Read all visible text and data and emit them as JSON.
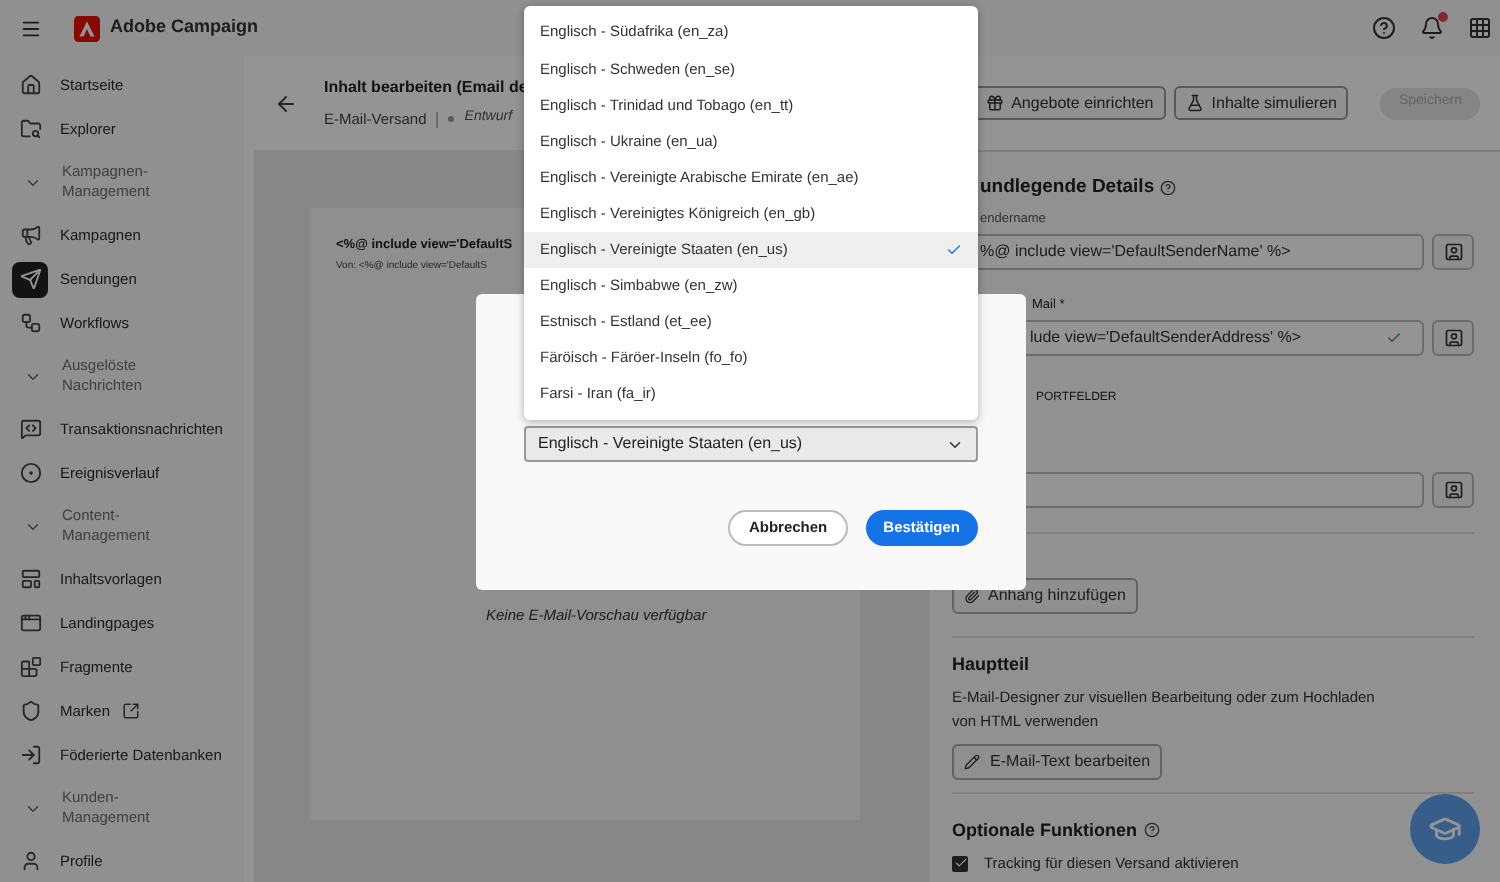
{
  "app_bar": {
    "product": "Adobe Campaign",
    "has_notifications": true
  },
  "sidebar": {
    "items": [
      {
        "kind": "item",
        "label": "Startseite",
        "selected": false,
        "external": false
      },
      {
        "kind": "item",
        "label": "Explorer",
        "selected": false,
        "external": false
      },
      {
        "kind": "group",
        "label": "Kampagnen-Management",
        "expanded": true
      },
      {
        "kind": "item",
        "label": "Kampagnen",
        "selected": false,
        "external": false
      },
      {
        "kind": "item",
        "label": "Sendungen",
        "selected": true,
        "external": false
      },
      {
        "kind": "item",
        "label": "Workflows",
        "selected": false,
        "external": false
      },
      {
        "kind": "group",
        "label": "Ausgelöste Nachrichten",
        "expanded": true
      },
      {
        "kind": "item",
        "label": "Transaktionsnachrichten",
        "selected": false,
        "external": false
      },
      {
        "kind": "item",
        "label": "Ereignisverlauf",
        "selected": false,
        "external": false
      },
      {
        "kind": "group",
        "label": "Content-Management",
        "expanded": true
      },
      {
        "kind": "item",
        "label": "Inhaltsvorlagen",
        "selected": false,
        "external": false
      },
      {
        "kind": "item",
        "label": "Landingpages",
        "selected": false,
        "external": false
      },
      {
        "kind": "item",
        "label": "Fragmente",
        "selected": false,
        "external": false
      },
      {
        "kind": "item",
        "label": "Marken",
        "selected": false,
        "external": true
      },
      {
        "kind": "item",
        "label": "Föderierte Datenbanken",
        "selected": false,
        "external": false
      },
      {
        "kind": "group",
        "label": "Kunden-Management",
        "expanded": true
      },
      {
        "kind": "item",
        "label": "Profile",
        "selected": false,
        "external": false
      }
    ]
  },
  "page": {
    "title": "Inhalt bearbeiten (Email de",
    "channel": "E-Mail-Versand",
    "status": "Entwurf",
    "actions": [
      "Angebote einrichten",
      "Inhalte simulieren"
    ],
    "save": {
      "label": "Speichern",
      "disabled": true
    }
  },
  "preview": {
    "subject": "<%@ include view='DefaultS",
    "from": "Von: <%@ include view='DefaultS",
    "empty_message": "Keine E-Mail-Vorschau verfügbar"
  },
  "details": {
    "title": "undlegende Details",
    "sender_name": {
      "label": "endername",
      "value": "%@ include view='DefaultSenderName' %>"
    },
    "sender_email": {
      "label": "Mail *",
      "value": "lude view='DefaultSenderAddress' %>",
      "valid": true
    },
    "section_label": "PORTFELDER",
    "attachment_button": "Anhang hinzufügen",
    "body": {
      "title": "Hauptteil",
      "description": "E-Mail-Designer zur visuellen Bearbeitung oder zum Hochladen von HTML verwenden",
      "button": "E-Mail-Text bearbeiten"
    },
    "options": {
      "title": "Optionale Funktionen",
      "tracking": {
        "label": "Tracking für diesen Versand aktivieren",
        "checked": true
      }
    }
  },
  "dialog": {
    "select": {
      "value": "Englisch - Vereinigte Staaten (en_us)",
      "options": [
        {
          "label": "Englisch - Südafrika (en_za)",
          "selected": false
        },
        {
          "label": "Englisch - Schweden (en_se)",
          "selected": false
        },
        {
          "label": "Englisch - Trinidad und Tobago (en_tt)",
          "selected": false
        },
        {
          "label": "Englisch - Ukraine (en_ua)",
          "selected": false
        },
        {
          "label": "Englisch - Vereinigte Arabische Emirate (en_ae)",
          "selected": false
        },
        {
          "label": "Englisch - Vereinigtes Königreich (en_gb)",
          "selected": false
        },
        {
          "label": "Englisch - Vereinigte Staaten (en_us)",
          "selected": true
        },
        {
          "label": "Englisch - Simbabwe (en_zw)",
          "selected": false
        },
        {
          "label": "Estnisch - Estland (et_ee)",
          "selected": false
        },
        {
          "label": "Färöisch - Färöer-Inseln (fo_fo)",
          "selected": false
        },
        {
          "label": "Farsi - Iran (fa_ir)",
          "selected": false
        }
      ]
    },
    "buttons": [
      {
        "kind": "secondary",
        "label": "Abbrechen"
      },
      {
        "kind": "primary",
        "label": "Bestätigen"
      }
    ]
  }
}
